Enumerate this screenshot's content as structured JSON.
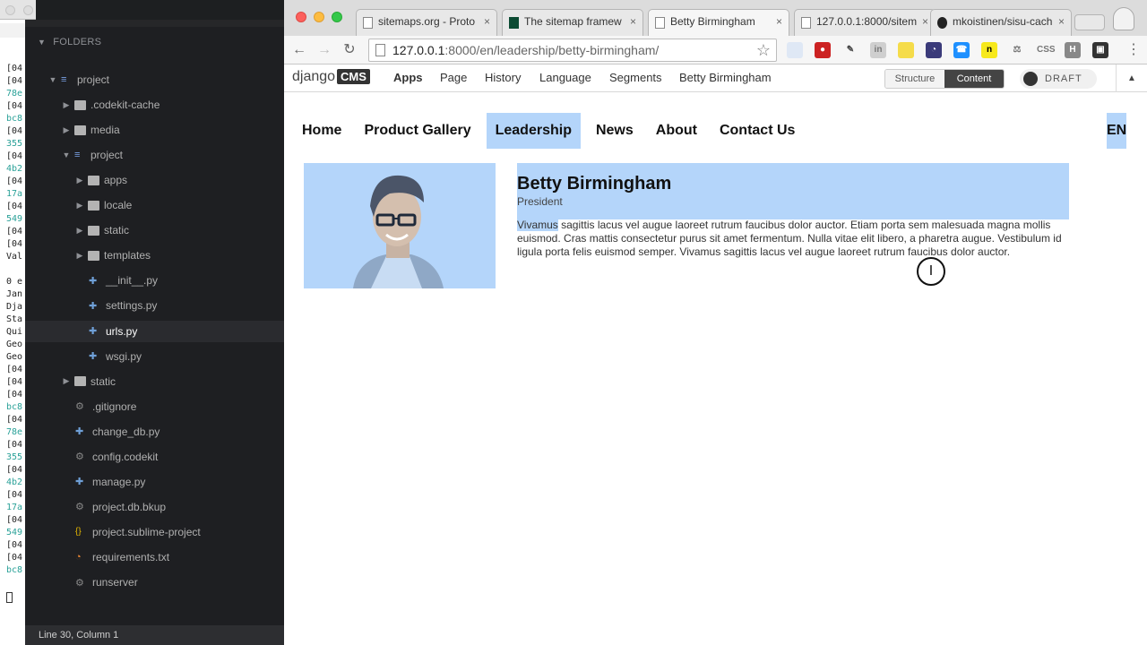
{
  "terminal": {
    "lines": [
      "[04",
      "[04",
      "78e",
      "[04",
      "bc8",
      "[04",
      "355",
      "[04",
      "4b2",
      "[04",
      "17a",
      "[04",
      "549",
      "[04",
      "[04",
      "Val",
      "",
      "0 e",
      "Jan",
      "Dja",
      "Sta",
      "Qui",
      "Geo",
      "Geo",
      "[04",
      "[04",
      "[04",
      "bc8",
      "[04",
      "78e",
      "[04",
      "355",
      "[04",
      "4b2",
      "[04",
      "17a",
      "[04",
      "549",
      "[04",
      "[04",
      "bc8"
    ]
  },
  "editor": {
    "sidebar_header": "FOLDERS",
    "tree": [
      {
        "label": "project",
        "kind": "project",
        "depth": 0,
        "chev": "▼"
      },
      {
        "label": ".codekit-cache",
        "kind": "folder",
        "depth": 1,
        "chev": "▶"
      },
      {
        "label": "media",
        "kind": "folder",
        "depth": 1,
        "chev": "▶"
      },
      {
        "label": "project",
        "kind": "project",
        "depth": 1,
        "chev": "▼"
      },
      {
        "label": "apps",
        "kind": "folder",
        "depth": 2,
        "chev": "▶"
      },
      {
        "label": "locale",
        "kind": "folder",
        "depth": 2,
        "chev": "▶"
      },
      {
        "label": "static",
        "kind": "folder",
        "depth": 2,
        "chev": "▶"
      },
      {
        "label": "templates",
        "kind": "folder",
        "depth": 2,
        "chev": "▶"
      },
      {
        "label": "__init__.py",
        "kind": "py",
        "depth": 2
      },
      {
        "label": "settings.py",
        "kind": "py",
        "depth": 2
      },
      {
        "label": "urls.py",
        "kind": "py",
        "depth": 2,
        "selected": true
      },
      {
        "label": "wsgi.py",
        "kind": "py",
        "depth": 2
      },
      {
        "label": "static",
        "kind": "folder",
        "depth": 1,
        "chev": "▶"
      },
      {
        "label": ".gitignore",
        "kind": "gear",
        "depth": 1
      },
      {
        "label": "change_db.py",
        "kind": "py",
        "depth": 1
      },
      {
        "label": "config.codekit",
        "kind": "gear",
        "depth": 1
      },
      {
        "label": "manage.py",
        "kind": "py",
        "depth": 1
      },
      {
        "label": "project.db.bkup",
        "kind": "gear",
        "depth": 1
      },
      {
        "label": "project.sublime-project",
        "kind": "json",
        "depth": 1
      },
      {
        "label": "requirements.txt",
        "kind": "rss",
        "depth": 1
      },
      {
        "label": "runserver",
        "kind": "gear",
        "depth": 1
      }
    ],
    "status": "Line 30, Column 1"
  },
  "browser": {
    "tabs": [
      {
        "title": "sitemaps.org - Proto",
        "icon": "page-icon"
      },
      {
        "title": "The sitemap framew",
        "icon": "django-icon"
      },
      {
        "title": "Betty Birmingham",
        "icon": "page-icon",
        "active": true
      },
      {
        "title": "127.0.0.1:8000/sitem",
        "icon": "page-icon"
      },
      {
        "title": "mkoistinen/sisu-cach",
        "icon": "github-icon"
      }
    ],
    "url_host": "127.0.0.1",
    "url_rest": ":8000/en/leadership/betty-birmingham/",
    "extensions": [
      "folder-ext-icon",
      "stop-ext-icon",
      "eyedropper-ext-icon",
      "linkedin-ext-icon",
      "lemon-ext-icon",
      "speed-ext-icon",
      "phone-ext-icon",
      "n-ext-icon",
      "scale-ext-icon",
      "css-ext-icon",
      "h-ext-icon",
      "camera-ext-icon"
    ],
    "css_ext_label": "CSS",
    "h_ext_label": "H"
  },
  "cms": {
    "logo_text": "django",
    "logo_badge": "CMS",
    "menu": [
      "Apps",
      "Page",
      "History",
      "Language",
      "Segments",
      "Betty Birmingham"
    ],
    "structure_label": "Structure",
    "content_label": "Content",
    "draft_label": "DRAFT"
  },
  "site": {
    "nav": [
      "Home",
      "Product Gallery",
      "Leadership",
      "News",
      "About",
      "Contact Us"
    ],
    "active_nav": "Leadership",
    "lang": "EN",
    "person": {
      "name": "Betty Birmingham",
      "role": "President",
      "bio_first_word": "Vivamus",
      "bio_rest": " sagittis lacus vel augue laoreet rutrum faucibus dolor auctor. Etiam porta sem malesuada magna mollis euismod. Cras mattis consectetur purus sit amet fermentum. Nulla vitae elit libero, a pharetra augue. Vestibulum id ligula porta felis euismod semper. Vivamus sagittis lacus vel augue laoreet rutrum faucibus dolor auctor."
    }
  },
  "colors": {
    "selection": "#b4d5fa",
    "editor_bg": "#1e1f22"
  }
}
